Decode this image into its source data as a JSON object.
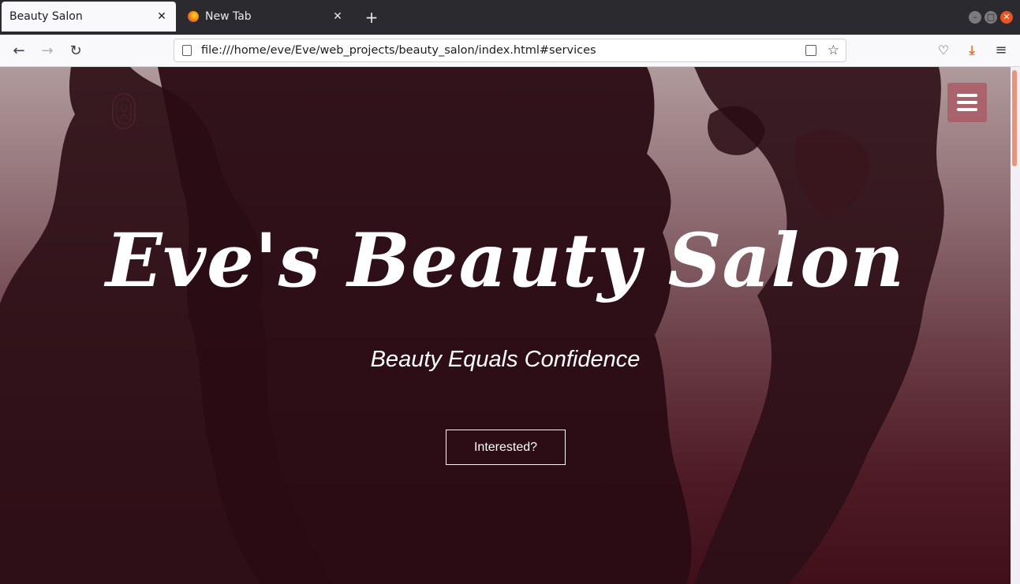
{
  "browser": {
    "tabs": [
      {
        "label": "Beauty Salon",
        "active": true
      },
      {
        "label": "New Tab",
        "active": false
      }
    ],
    "url": "file:///home/eve/Eve/web_projects/beauty_salon/index.html#services",
    "accent": "#e95420"
  },
  "hero": {
    "title": "Eve's Beauty Salon",
    "subtitle": "Beauty Equals Confidence",
    "cta_label": "Interested?"
  },
  "colors": {
    "overlay_top": "#b09a9c",
    "overlay_bottom": "#40101a",
    "silhouette": "#2e0f17",
    "menu_button": "#aa5c66"
  }
}
